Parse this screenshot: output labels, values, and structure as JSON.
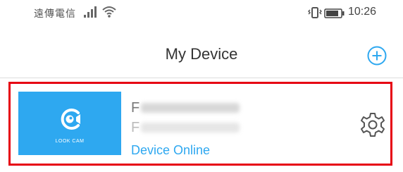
{
  "status_bar": {
    "carrier": "遠傳電信",
    "time": "10:26",
    "icons": [
      "signal-icon",
      "wifi-icon",
      "vibrate-icon",
      "battery-icon"
    ]
  },
  "header": {
    "title": "My Device",
    "add_icon": "plus-circle-icon"
  },
  "device": {
    "thumbnail_brand": "LOOK CAM",
    "name_prefix": "F",
    "id_prefix": "F",
    "status": "Device Online",
    "settings_icon": "gear-icon"
  },
  "colors": {
    "accent": "#2ea8f0",
    "highlight_border": "#e60012",
    "title_text": "#333333"
  }
}
